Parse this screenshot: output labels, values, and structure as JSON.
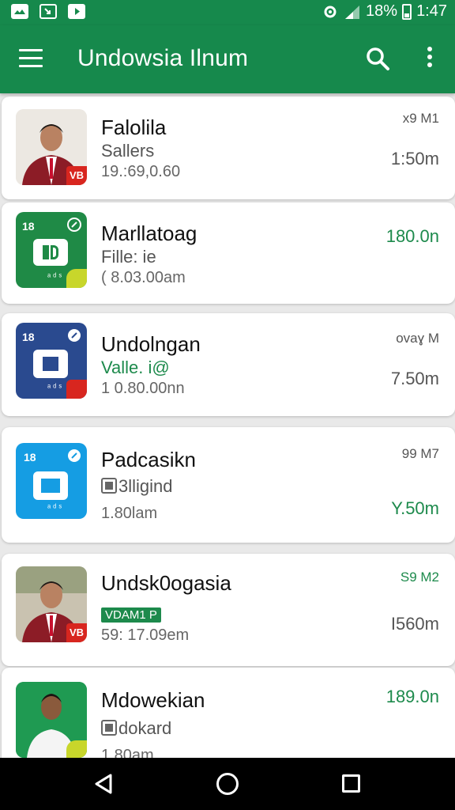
{
  "status_bar": {
    "battery_text": "18%",
    "time": "1:47",
    "icons": [
      "image-icon",
      "screenshot-icon",
      "play-store-icon",
      "wifi-settings-icon",
      "signal-icon",
      "battery-icon"
    ]
  },
  "app_bar": {
    "title": "Undowsia Ilnum",
    "icons": [
      "menu-icon",
      "search-icon",
      "more-vertical-icon"
    ]
  },
  "items": [
    {
      "name": "Falolila",
      "sub": "Sallers",
      "meta": "19.:69,0.60",
      "small": "x9 M1",
      "price": "1:50m",
      "thumb": "person-red-jacket"
    },
    {
      "name": "Marllatoag",
      "sub": "Fille: ie",
      "meta": "( 8.03.00am",
      "small": "",
      "price": "180.0n",
      "thumb": "green-app-icon"
    },
    {
      "name": "Undolngan",
      "sub": "Valle. i@",
      "meta": "1 0.80.00nn",
      "small": "ovaɣ M",
      "price": "7.50m",
      "thumb": "navy-app-icon"
    },
    {
      "name": "Padcasikn",
      "sub": "3lligind",
      "meta": "1.80lam",
      "small": "99 M7",
      "price": "Y.50m",
      "thumb": "blue-app-icon"
    },
    {
      "name": "Undsk0ogasia",
      "sub": "VDAM1 P",
      "meta": "59: 17.09em",
      "small": "S9 M2",
      "price": "I560m",
      "thumb": "person-red-jacket"
    },
    {
      "name": "Mdowekian",
      "sub": "dokard",
      "meta": "1.80am",
      "small": "",
      "price": "189.0n",
      "thumb": "person-white-shirt"
    }
  ],
  "thumb_labels": {
    "tile_top": "18",
    "tile_bottom": "ᵃ ᵈ ˢ",
    "badge": "VB"
  },
  "colors": {
    "primary": "#16894c",
    "accent_green": "#1d8a4c",
    "tile_green": "#1f8a46",
    "tile_navy": "#2a4a8f",
    "tile_blue": "#159de3",
    "badge_red": "#d8261f"
  },
  "nav_bar": {
    "icons": [
      "back-icon",
      "home-icon",
      "recent-apps-icon"
    ]
  }
}
